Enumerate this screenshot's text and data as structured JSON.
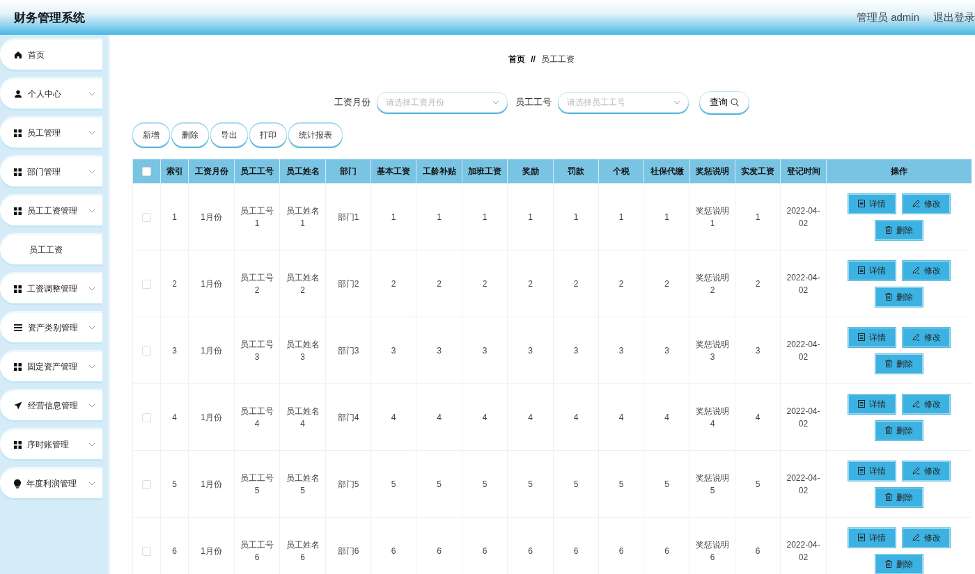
{
  "header": {
    "title": "财务管理系统",
    "user": "管理员 admin",
    "logout": "退出登录"
  },
  "sidebar": {
    "items": [
      {
        "label": "首页",
        "kind": "home",
        "expandable": false
      },
      {
        "label": "个人中心",
        "kind": "user",
        "expandable": true
      },
      {
        "label": "员工管理",
        "kind": "grid",
        "expandable": true
      },
      {
        "label": "部门管理",
        "kind": "grid",
        "expandable": true
      },
      {
        "label": "员工工资管理",
        "kind": "grid",
        "expandable": true,
        "children": [
          {
            "label": "员工工资"
          }
        ]
      },
      {
        "label": "工资调整管理",
        "kind": "grid",
        "expandable": true
      },
      {
        "label": "资产类别管理",
        "kind": "list",
        "expandable": true
      },
      {
        "label": "固定资产管理",
        "kind": "grid",
        "expandable": true
      },
      {
        "label": "经营信息管理",
        "kind": "send",
        "expandable": true
      },
      {
        "label": "序时账管理",
        "kind": "grid",
        "expandable": true
      },
      {
        "label": "年度利润管理",
        "kind": "bulb",
        "expandable": true
      }
    ]
  },
  "breadcrumb": {
    "home": "首页",
    "separator": "//",
    "current": "员工工资"
  },
  "search": {
    "fields": [
      {
        "label": "工资月份",
        "placeholder": "请选择工资月份"
      },
      {
        "label": "员工工号",
        "placeholder": "请选择员工工号"
      }
    ],
    "button": "查询"
  },
  "toolbar": [
    "新增",
    "删除",
    "导出",
    "打印",
    "统计报表"
  ],
  "table": {
    "select_all": false,
    "columns": [
      "索引",
      "工资月份",
      "员工工号",
      "员工姓名",
      "部门",
      "基本工资",
      "工龄补贴",
      "加班工资",
      "奖励",
      "罚款",
      "个税",
      "社保代缴",
      "奖惩说明",
      "实发工资",
      "登记时间",
      "操作"
    ],
    "rows": [
      {
        "checked": false,
        "cells": [
          "1",
          "1月份",
          "员工工号1",
          "员工姓名1",
          "部门1",
          "1",
          "1",
          "1",
          "1",
          "1",
          "1",
          "1",
          "奖惩说明1",
          "1",
          "2022-04-02"
        ],
        "actions": [
          "详情",
          "修改",
          "删除"
        ]
      },
      {
        "checked": false,
        "cells": [
          "2",
          "1月份",
          "员工工号2",
          "员工姓名2",
          "部门2",
          "2",
          "2",
          "2",
          "2",
          "2",
          "2",
          "2",
          "奖惩说明2",
          "2",
          "2022-04-02"
        ],
        "actions": [
          "详情",
          "修改",
          "删除"
        ]
      },
      {
        "checked": false,
        "cells": [
          "3",
          "1月份",
          "员工工号3",
          "员工姓名3",
          "部门3",
          "3",
          "3",
          "3",
          "3",
          "3",
          "3",
          "3",
          "奖惩说明3",
          "3",
          "2022-04-02"
        ],
        "actions": [
          "详情",
          "修改",
          "删除"
        ]
      },
      {
        "checked": false,
        "cells": [
          "4",
          "1月份",
          "员工工号4",
          "员工姓名4",
          "部门4",
          "4",
          "4",
          "4",
          "4",
          "4",
          "4",
          "4",
          "奖惩说明4",
          "4",
          "2022-04-02"
        ],
        "actions": [
          "详情",
          "修改",
          "删除"
        ]
      },
      {
        "checked": false,
        "cells": [
          "5",
          "1月份",
          "员工工号5",
          "员工姓名5",
          "部门5",
          "5",
          "5",
          "5",
          "5",
          "5",
          "5",
          "5",
          "奖惩说明5",
          "5",
          "2022-04-02"
        ],
        "actions": [
          "详情",
          "修改",
          "删除"
        ]
      },
      {
        "checked": false,
        "cells": [
          "6",
          "1月份",
          "员工工号6",
          "员工姓名6",
          "部门6",
          "6",
          "6",
          "6",
          "6",
          "6",
          "6",
          "6",
          "奖惩说明6",
          "6",
          "2022-04-02"
        ],
        "actions": [
          "详情",
          "修改",
          "删除"
        ]
      }
    ]
  }
}
